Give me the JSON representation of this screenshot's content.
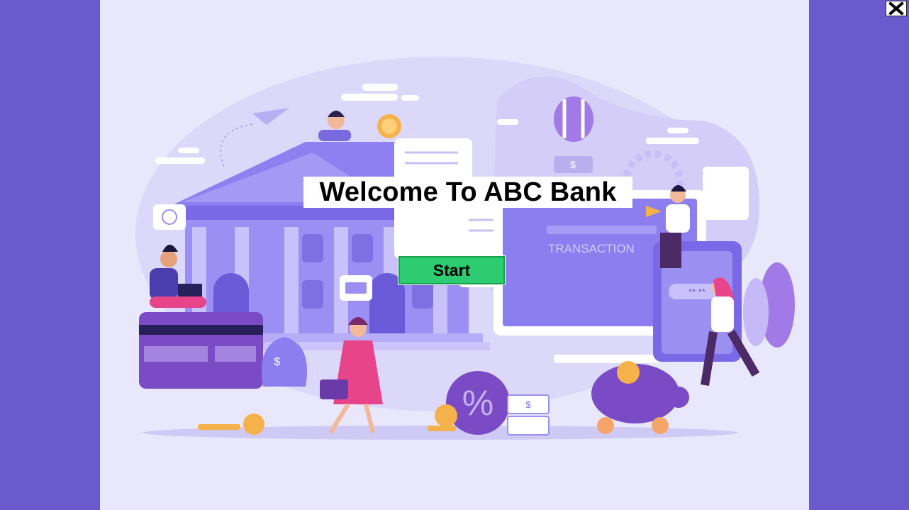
{
  "window": {
    "close_icon": "close-x-icon"
  },
  "welcome": {
    "title": "Welcome To ABC Bank",
    "start_label": "Start"
  },
  "illustration": {
    "transaction_label": "TRANSACTION",
    "currency_symbol": "$",
    "percent_symbol": "%",
    "password_mask": "** **"
  },
  "colors": {
    "side_panel": "#6a5acd",
    "stage_bg": "#e9e7fb",
    "start_button": "#2ecc71",
    "accent_purple": "#7b61e8",
    "coin": "#f6b24a"
  }
}
